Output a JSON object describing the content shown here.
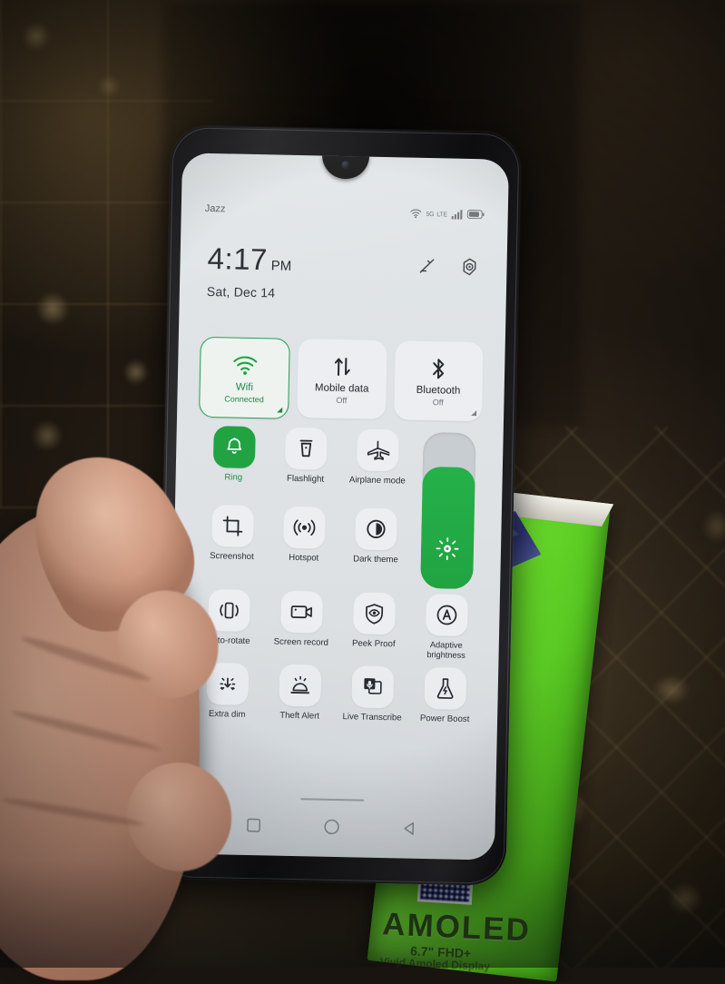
{
  "scene": {
    "description": "hand-held smartphone showing quick settings panel",
    "box_text": {
      "brand": "AMOLED",
      "line2": "6.7\" FHD+",
      "line3": "Vivid Amoled Display"
    }
  },
  "statusbar": {
    "carrier": "Jazz",
    "network_line1": "5G",
    "network_line2": "LTE",
    "icons": [
      "wifi-icon",
      "network-type-icon",
      "signal-bars-icon",
      "battery-icon"
    ]
  },
  "header": {
    "time": "4:17",
    "ampm": "PM",
    "date": "Sat, Dec 14",
    "edit_icon": "edit-pencil-icon",
    "settings_icon": "settings-gear-icon"
  },
  "connectivity_tiles": [
    {
      "label": "Wifi",
      "status": "Connected",
      "icon": "wifi-icon",
      "active": true
    },
    {
      "label": "Mobile data",
      "status": "Off",
      "icon": "mobile-data-icon",
      "active": false
    },
    {
      "label": "Bluetooth",
      "status": "Off",
      "icon": "bluetooth-icon",
      "active": false
    }
  ],
  "quick_tiles_upper": [
    {
      "label": "Ring",
      "icon": "bell-icon",
      "active": true
    },
    {
      "label": "Flashlight",
      "icon": "flashlight-icon",
      "active": false
    },
    {
      "label": "Airplane mode",
      "icon": "airplane-icon",
      "active": false
    },
    {
      "label": "Screenshot",
      "icon": "crop-icon",
      "active": false
    },
    {
      "label": "Hotspot",
      "icon": "hotspot-icon",
      "active": false
    },
    {
      "label": "Dark theme",
      "icon": "dark-theme-icon",
      "active": false
    }
  ],
  "quick_tiles_lower": [
    {
      "label": "Auto-rotate",
      "icon": "auto-rotate-icon",
      "active": false
    },
    {
      "label": "Screen record",
      "icon": "screen-record-icon",
      "active": false
    },
    {
      "label": "Peek Proof",
      "icon": "peek-proof-icon",
      "active": false
    },
    {
      "label": "Adaptive brightness",
      "icon": "adaptive-brightness-icon",
      "active": false
    },
    {
      "label": "Extra dim",
      "icon": "extra-dim-icon",
      "active": false
    },
    {
      "label": "Theft Alert",
      "icon": "theft-alert-icon",
      "active": false
    },
    {
      "label": "Live Transcribe",
      "icon": "live-transcribe-icon",
      "active": false
    },
    {
      "label": "Power Boost",
      "icon": "power-boost-icon",
      "active": false
    }
  ],
  "brightness": {
    "icon": "brightness-sun-icon",
    "level_percent": 78
  },
  "navbar": [
    {
      "name": "recents",
      "icon": "square-icon"
    },
    {
      "name": "home",
      "icon": "circle-icon"
    },
    {
      "name": "back",
      "icon": "triangle-left-icon"
    }
  ],
  "colors": {
    "accent_green": "#21a342",
    "tile_bg": "#eceef1",
    "screen_bg": "#dfe4e6",
    "text_primary": "#24282c",
    "text_secondary": "#6d747a"
  }
}
